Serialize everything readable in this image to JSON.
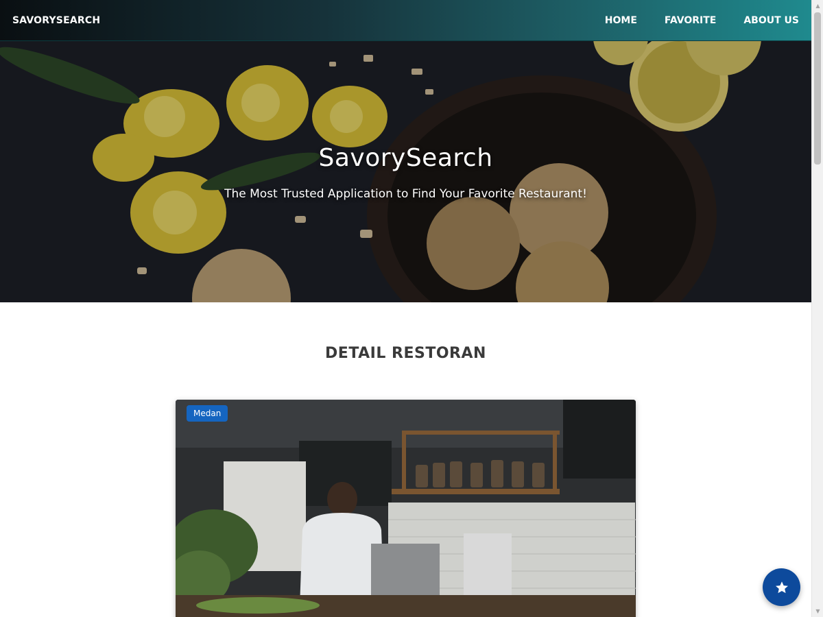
{
  "header": {
    "brand": "SAVORYSEARCH",
    "nav": [
      {
        "label": "HOME"
      },
      {
        "label": "FAVORITE"
      },
      {
        "label": "ABOUT US"
      }
    ]
  },
  "hero": {
    "title": "SavorySearch",
    "subtitle": "The Most Trusted Application to Find Your Favorite Restaurant!"
  },
  "main": {
    "section_title": "DETAIL RESTORAN",
    "restaurant": {
      "city": "Medan"
    }
  },
  "fab": {
    "icon": "star-icon"
  },
  "colors": {
    "accent": "#1f8a8e",
    "badge": "#1565c0",
    "fab": "#0d4a9c"
  }
}
